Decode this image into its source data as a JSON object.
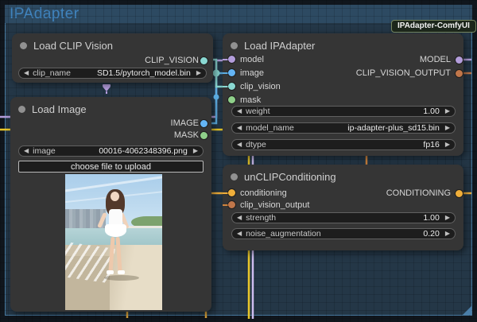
{
  "group": {
    "title": "IPAdapter"
  },
  "badge": {
    "label": "IPAdapter-ComfyUI"
  },
  "icons": {
    "left_arrow": "◀",
    "right_arrow": "▶"
  },
  "colors": {
    "group_title": "#4084bf",
    "header_dot": "#919191",
    "model": "#b39ddb",
    "image": "#64b5f6",
    "clip_vision": "#8ad8d2",
    "mask": "#8fd08a",
    "conditioning": "#efae3a",
    "clip_vision_output": "#c0764a",
    "wire_yellow": "#e9c72a",
    "wire_lavender": "#cdbcee",
    "wire_orange": "#cf843e",
    "wire_orange2": "#dca43c",
    "wire_blue": "#5caee3",
    "wire_cyan": "#8ad8d2",
    "wire_purple": "#b39ddb"
  },
  "nodes": {
    "load_clip_vision": {
      "title": "Load CLIP Vision",
      "outputs": [
        {
          "label": "CLIP_VISION"
        }
      ],
      "widgets": [
        {
          "name": "clip_name",
          "value": "SD1.5/pytorch_model.bin"
        }
      ]
    },
    "load_image": {
      "title": "Load Image",
      "outputs": [
        {
          "label": "IMAGE"
        },
        {
          "label": "MASK"
        }
      ],
      "widgets": [
        {
          "name": "image",
          "value": "00016-4062348396.png"
        }
      ],
      "button": "choose file to upload"
    },
    "load_ipadapter": {
      "title": "Load IPAdapter",
      "inputs": [
        {
          "label": "model"
        },
        {
          "label": "image"
        },
        {
          "label": "clip_vision"
        },
        {
          "label": "mask"
        }
      ],
      "outputs": [
        {
          "label": "MODEL"
        },
        {
          "label": "CLIP_VISION_OUTPUT"
        }
      ],
      "widgets": [
        {
          "name": "weight",
          "value": "1.00"
        },
        {
          "name": "model_name",
          "value": "ip-adapter-plus_sd15.bin"
        },
        {
          "name": "dtype",
          "value": "fp16"
        }
      ]
    },
    "unclip_conditioning": {
      "title": "unCLIPConditioning",
      "inputs": [
        {
          "label": "conditioning"
        },
        {
          "label": "clip_vision_output"
        }
      ],
      "outputs": [
        {
          "label": "CONDITIONING"
        }
      ],
      "widgets": [
        {
          "name": "strength",
          "value": "1.00"
        },
        {
          "name": "noise_augmentation",
          "value": "0.20"
        }
      ]
    }
  }
}
